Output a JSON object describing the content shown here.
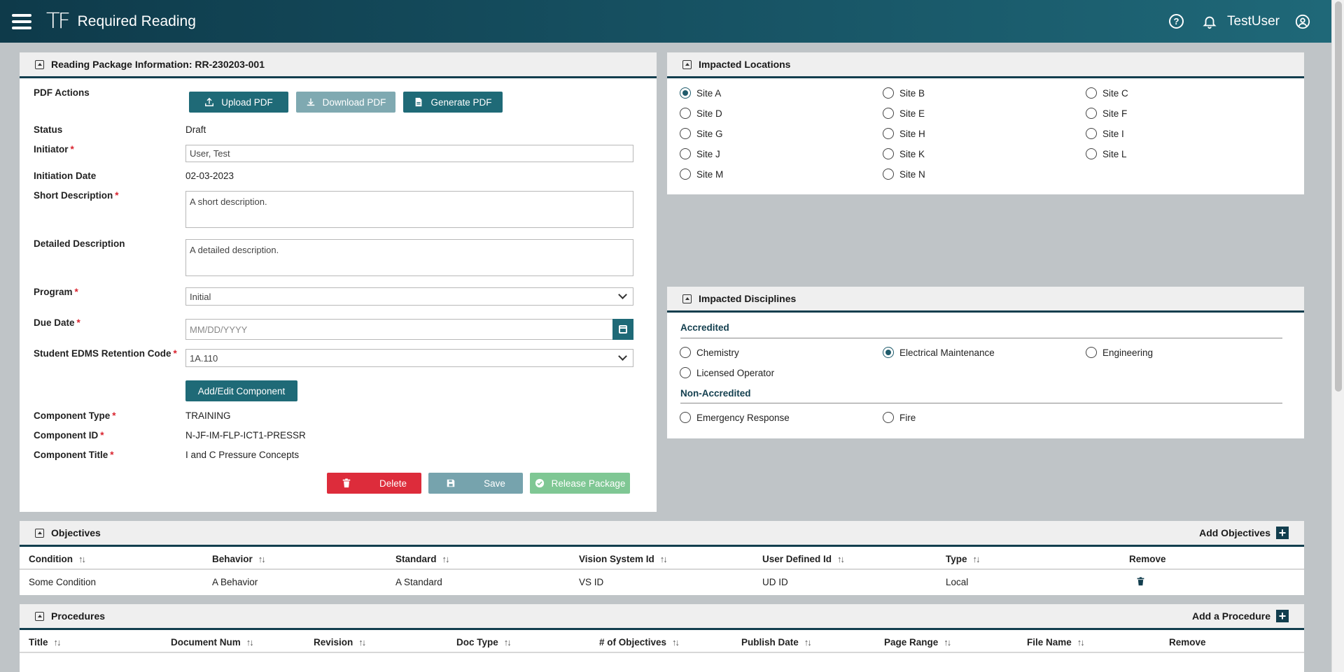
{
  "app": {
    "title": "Required Reading",
    "logo": "TF",
    "username": "TestUser"
  },
  "reading_package": {
    "header": "Reading Package Information: RR-230203-001",
    "pdf_actions_label": "PDF Actions",
    "upload_pdf": "Upload PDF",
    "download_pdf": "Download PDF",
    "generate_pdf": "Generate PDF",
    "status_label": "Status",
    "status_value": "Draft",
    "initiator_label": "Initiator",
    "initiator_value": "User, Test",
    "initiation_date_label": "Initiation Date",
    "initiation_date_value": "02-03-2023",
    "short_desc_label": "Short Description",
    "short_desc_value": "A short description.",
    "detailed_desc_label": "Detailed Description",
    "detailed_desc_value": "A detailed description.",
    "program_label": "Program",
    "program_value": "Initial",
    "due_date_label": "Due Date",
    "due_date_placeholder": "MM/DD/YYYY",
    "retention_label": "Student EDMS Retention Code",
    "retention_value": "1A.110",
    "add_edit_component": "Add/Edit Component",
    "component_type_label": "Component Type",
    "component_type_value": "TRAINING",
    "component_id_label": "Component ID",
    "component_id_value": "N-JF-IM-FLP-ICT1-PRESSR",
    "component_title_label": "Component Title",
    "component_title_value": "I and C Pressure Concepts",
    "delete": "Delete",
    "save": "Save",
    "release": "Release Package",
    "required_mark": "*"
  },
  "impacted_locations": {
    "header": "Impacted Locations",
    "sites": [
      "Site A",
      "Site B",
      "Site C",
      "Site D",
      "Site E",
      "Site F",
      "Site G",
      "Site H",
      "Site I",
      "Site J",
      "Site K",
      "Site L",
      "Site M",
      "Site N"
    ],
    "selected": "Site A"
  },
  "impacted_disciplines": {
    "header": "Impacted Disciplines",
    "accredited_label": "Accredited",
    "accredited": [
      "Chemistry",
      "Electrical Maintenance",
      "Engineering",
      "Licensed Operator"
    ],
    "non_accredited_label": "Non-Accredited",
    "non_accredited": [
      "Emergency Response",
      "Fire"
    ],
    "selected": "Electrical Maintenance"
  },
  "objectives": {
    "header": "Objectives",
    "add_label": "Add Objectives",
    "columns": [
      "Condition",
      "Behavior",
      "Standard",
      "Vision System Id",
      "User Defined Id",
      "Type",
      "Remove"
    ],
    "rows": [
      [
        "Some Condition",
        "A Behavior",
        "A Standard",
        "VS ID",
        "UD ID",
        "Local"
      ]
    ]
  },
  "procedures": {
    "header": "Procedures",
    "add_label": "Add a Procedure",
    "columns": [
      "Title",
      "Document Num",
      "Revision",
      "Doc Type",
      "# of Objectives",
      "Publish Date",
      "Page Range",
      "File Name",
      "Remove"
    ]
  },
  "icons": {
    "sort": "sort-icon",
    "collapse": "collapse-icon"
  },
  "colors": {
    "primary": "#1f6a77",
    "header_dark": "#123e4e",
    "danger": "#dd2c3b",
    "success": "#7fc794"
  }
}
